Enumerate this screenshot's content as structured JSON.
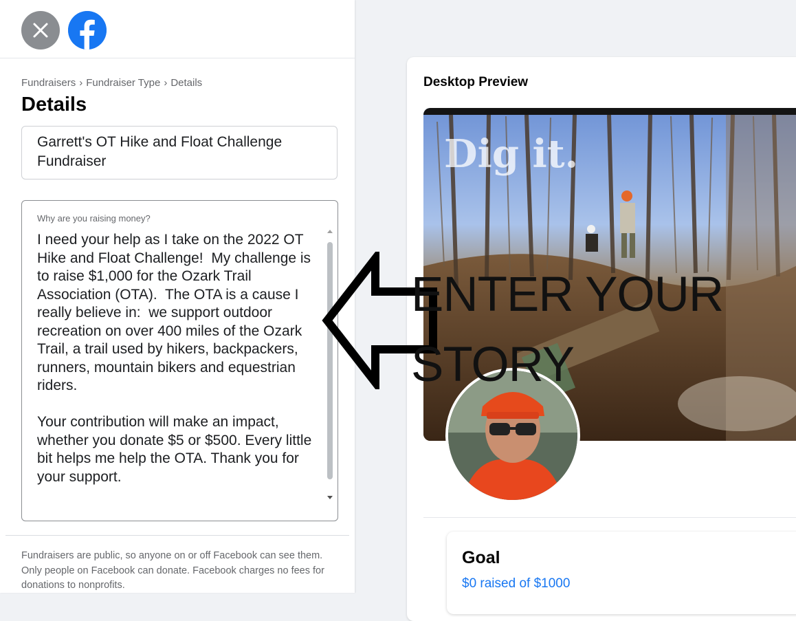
{
  "breadcrumb": {
    "items": [
      "Fundraisers",
      "Fundraiser Type",
      "Details"
    ],
    "separator": "›"
  },
  "page_title": "Details",
  "form": {
    "title_value": "Garrett's OT Hike and Float Challenge Fundraiser",
    "story_label": "Why are you raising money?",
    "story_value": "I need your help as I take on the 2022 OT Hike and Float Challenge!  My challenge is to raise $1,000 for the Ozark Trail Association (OTA).  The OTA is a cause I really believe in:  we support outdoor recreation on over 400 miles of the Ozark Trail, a trail used by hikers, backpackers, runners, mountain bikers and equestrian riders.\n\nYour contribution will make an impact, whether you donate $5 or $500. Every little bit helps me help the OTA. Thank you for your support."
  },
  "disclaimer": "Fundraisers are public, so anyone on or off Facebook can see them. Only people on Facebook can donate. Facebook charges no fees for donations to nonprofits.",
  "preview": {
    "label": "Desktop Preview",
    "cover_text": "Dig it.",
    "goal_title": "Goal",
    "goal_raised": "$0 raised of $1000"
  },
  "annotation": {
    "text": "ENTER YOUR STORY"
  },
  "icons": {
    "close": "close-icon",
    "logo": "facebook-logo-icon",
    "arrow": "left-arrow-outline-icon"
  },
  "colors": {
    "facebook_blue": "#1877f2",
    "close_gray": "#8a8d91",
    "muted_text": "#65676b"
  }
}
